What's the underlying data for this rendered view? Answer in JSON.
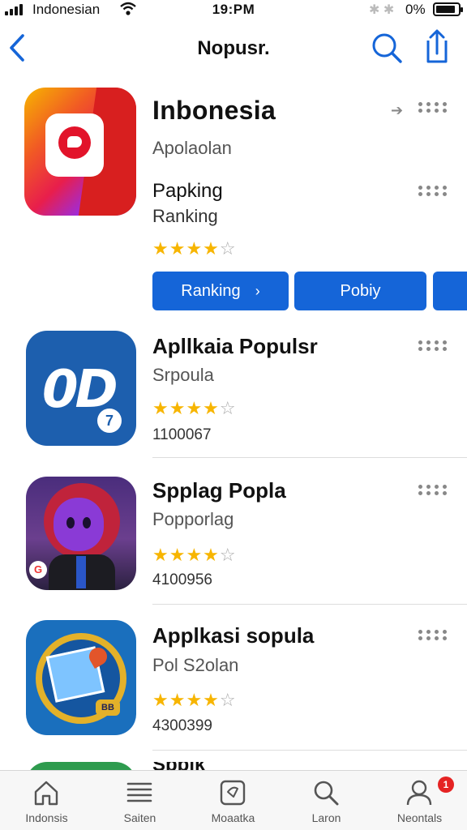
{
  "status_bar": {
    "carrier": "Indonesian",
    "time": "19:PM",
    "battery": "0%"
  },
  "nav": {
    "title": "Nopusr."
  },
  "featured": {
    "title": "Inbonesia",
    "subtitle": "Apolaolan",
    "name": "Papking",
    "rank": "Ranking",
    "rating": 4,
    "buttons": [
      "Ranking",
      "Pobiy"
    ]
  },
  "apps": [
    {
      "title": "Apllkaia Populsr",
      "subtitle": "Srpoula",
      "rating": 4,
      "count": "1100067"
    },
    {
      "title": "Spplag Popla",
      "subtitle": "Popporlag",
      "rating": 4,
      "count": "4100956"
    },
    {
      "title": "Applkasi sopula",
      "subtitle": "Pol S2olan",
      "rating": 4,
      "count": "4300399"
    }
  ],
  "icon_badges": {
    "app1": "7",
    "app3": "BB"
  },
  "peek_title": "Spplk",
  "tabs": [
    {
      "label": "Indonsis",
      "icon": "home-icon"
    },
    {
      "label": "Saiten",
      "icon": "list-icon"
    },
    {
      "label": "Moaatka",
      "icon": "store-icon"
    },
    {
      "label": "Laron",
      "icon": "search-icon"
    },
    {
      "label": "Neontals",
      "icon": "person-icon"
    }
  ],
  "notification_count": "1",
  "colors": {
    "accent": "#1565d8",
    "star": "#f7b500",
    "badge": "#e52323"
  }
}
